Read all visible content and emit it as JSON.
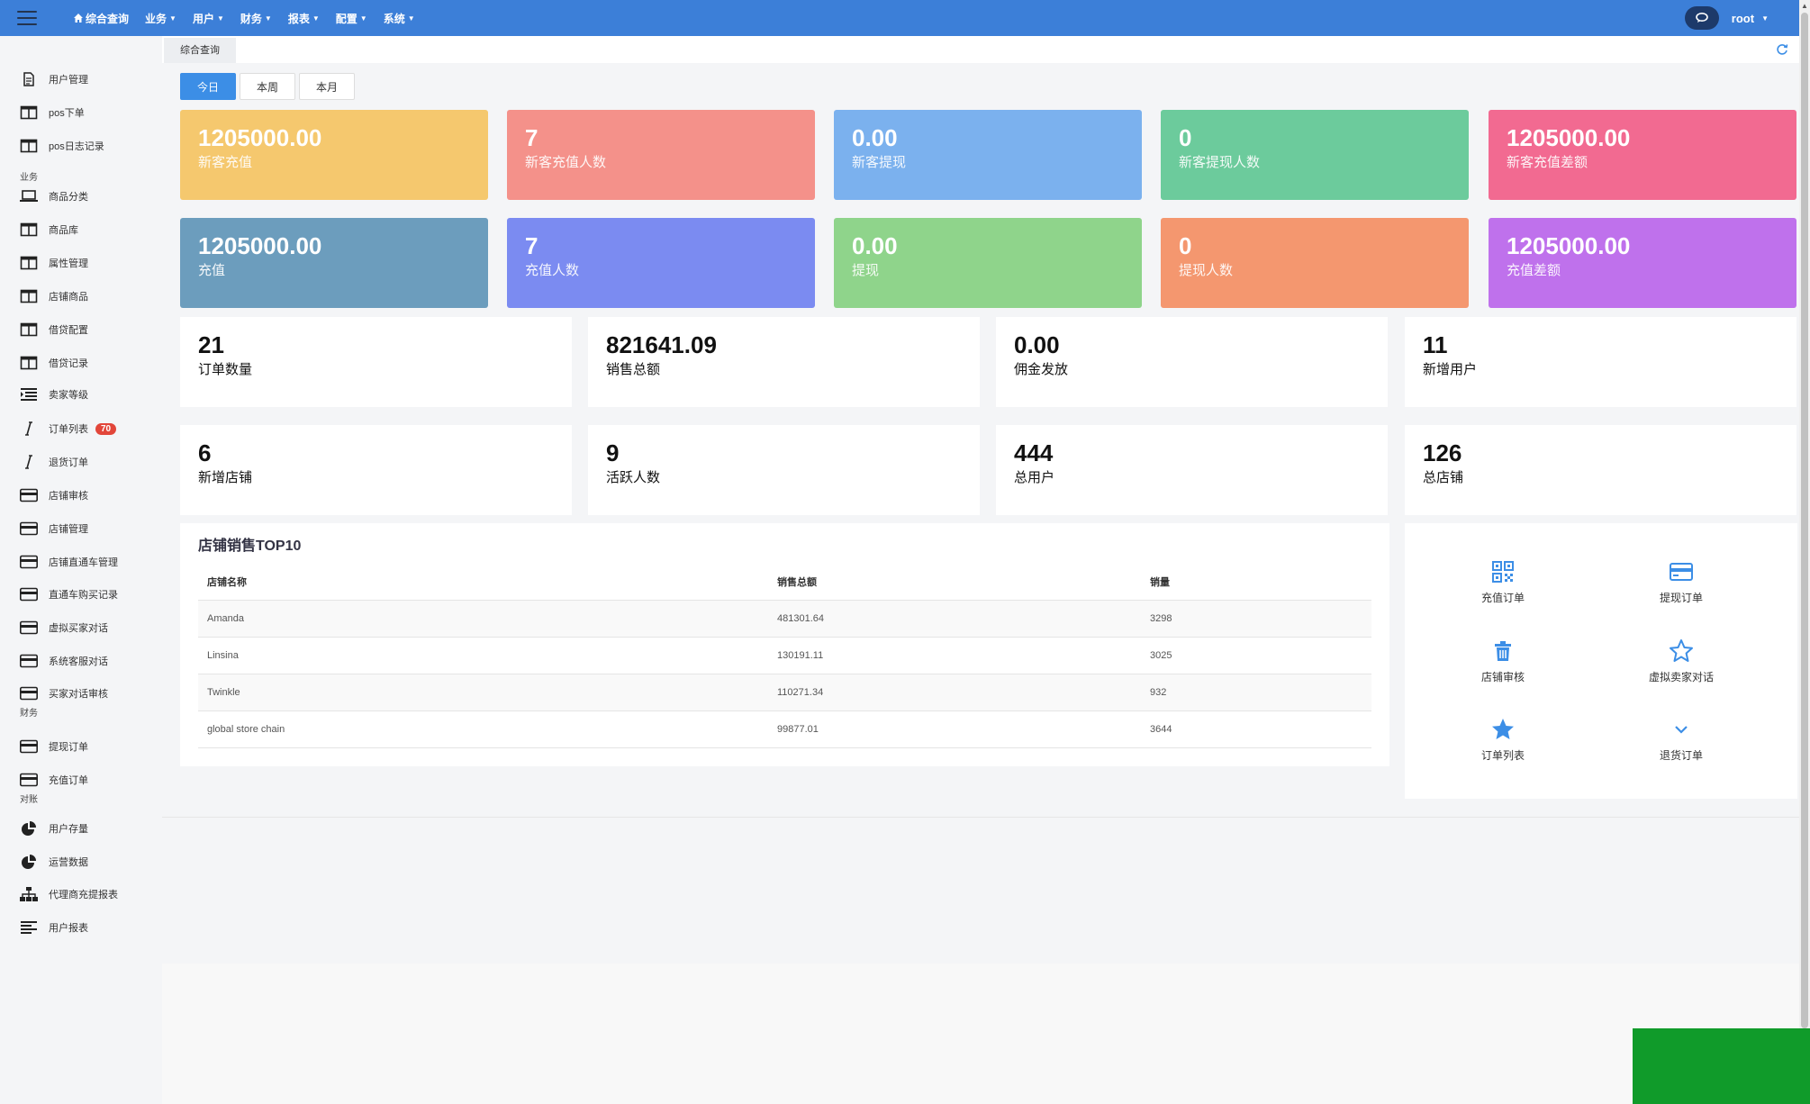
{
  "topbar": {
    "nav": [
      {
        "label": "综合查询",
        "home": true
      },
      {
        "label": "业务"
      },
      {
        "label": "用户"
      },
      {
        "label": "财务"
      },
      {
        "label": "报表"
      },
      {
        "label": "配置"
      },
      {
        "label": "系统"
      }
    ],
    "user": "root"
  },
  "sidebar": {
    "items": [
      {
        "label": "用户管理",
        "icon": "file-icon"
      },
      {
        "label": "pos下单",
        "icon": "table-icon"
      },
      {
        "label": "pos日志记录",
        "icon": "table-icon"
      },
      {
        "group": "业务"
      },
      {
        "label": "商品分类",
        "icon": "laptop-icon"
      },
      {
        "label": "商品库",
        "icon": "table-icon"
      },
      {
        "label": "属性管理",
        "icon": "table-icon"
      },
      {
        "label": "店铺商品",
        "icon": "table-icon"
      },
      {
        "label": "借贷配置",
        "icon": "table-icon"
      },
      {
        "label": "借贷记录",
        "icon": "table-icon"
      },
      {
        "label": "卖家等级",
        "icon": "list-indent-icon"
      },
      {
        "label": "订单列表",
        "icon": "italic-icon",
        "badge": "70"
      },
      {
        "label": "退货订单",
        "icon": "italic-icon"
      },
      {
        "label": "店铺审核",
        "icon": "credit-card-icon"
      },
      {
        "label": "店铺管理",
        "icon": "credit-card-icon"
      },
      {
        "label": "店铺直通车管理",
        "icon": "credit-card-icon"
      },
      {
        "label": "直通车购买记录",
        "icon": "credit-card-icon"
      },
      {
        "label": "虚拟买家对话",
        "icon": "credit-card-icon"
      },
      {
        "label": "系统客服对话",
        "icon": "credit-card-icon"
      },
      {
        "label": "买家对话审核",
        "icon": "credit-card-icon"
      },
      {
        "group": "财务"
      },
      {
        "label": "提现订单",
        "icon": "credit-card-icon"
      },
      {
        "label": "充值订单",
        "icon": "credit-card-icon"
      },
      {
        "group": "对账"
      },
      {
        "label": "用户存量",
        "icon": "pie-chart-icon"
      },
      {
        "label": "运营数据",
        "icon": "pie-chart-icon"
      },
      {
        "label": "代理商充提报表",
        "icon": "sitemap-icon"
      },
      {
        "label": "用户报表",
        "icon": "align-left-icon"
      }
    ]
  },
  "tabs": {
    "active": "综合查询"
  },
  "period": {
    "today": "今日",
    "week": "本周",
    "month": "本月"
  },
  "colors": {
    "accent": "#3c8ee6",
    "topbar": "#3c7fd8"
  },
  "stats_row1": [
    {
      "value": "1205000.00",
      "label": "新客充值",
      "color": "#f5c86e"
    },
    {
      "value": "7",
      "label": "新客充值人数",
      "color": "#f4918a"
    },
    {
      "value": "0.00",
      "label": "新客提现",
      "color": "#7bb1ee"
    },
    {
      "value": "0",
      "label": "新客提现人数",
      "color": "#6ccb9c"
    },
    {
      "value": "1205000.00",
      "label": "新客充值差额",
      "color": "#f26a91"
    }
  ],
  "stats_row2": [
    {
      "value": "1205000.00",
      "label": "充值",
      "color": "#6c9dbd"
    },
    {
      "value": "7",
      "label": "充值人数",
      "color": "#7b8bf1"
    },
    {
      "value": "0.00",
      "label": "提现",
      "color": "#8fd48b"
    },
    {
      "value": "0",
      "label": "提现人数",
      "color": "#f4976f"
    },
    {
      "value": "1205000.00",
      "label": "充值差额",
      "color": "#bf71ec"
    }
  ],
  "info_row1": [
    {
      "value": "21",
      "label": "订单数量"
    },
    {
      "value": "821641.09",
      "label": "销售总额"
    },
    {
      "value": "0.00",
      "label": "佣金发放"
    },
    {
      "value": "11",
      "label": "新增用户"
    }
  ],
  "info_row2": [
    {
      "value": "6",
      "label": "新增店铺"
    },
    {
      "value": "9",
      "label": "活跃人数"
    },
    {
      "value": "444",
      "label": "总用户"
    },
    {
      "value": "126",
      "label": "总店铺"
    }
  ],
  "top10": {
    "title": "店铺销售TOP10",
    "headers": [
      "店铺名称",
      "销售总额",
      "销量"
    ],
    "rows": [
      [
        "Amanda",
        "481301.64",
        "3298"
      ],
      [
        "Linsina",
        "130191.11",
        "3025"
      ],
      [
        "Twinkle",
        "110271.34",
        "932"
      ],
      [
        "global store chain",
        "99877.01",
        "3644"
      ]
    ]
  },
  "quick": [
    {
      "label": "充值订单",
      "icon": "qrcode-icon"
    },
    {
      "label": "提现订单",
      "icon": "credit-card-icon"
    },
    {
      "label": "店铺审核",
      "icon": "trash-icon"
    },
    {
      "label": "虚拟卖家对话",
      "icon": "star-outline-icon"
    },
    {
      "label": "订单列表",
      "icon": "star-icon"
    },
    {
      "label": "退货订单",
      "icon": "chevron-down-icon"
    }
  ]
}
